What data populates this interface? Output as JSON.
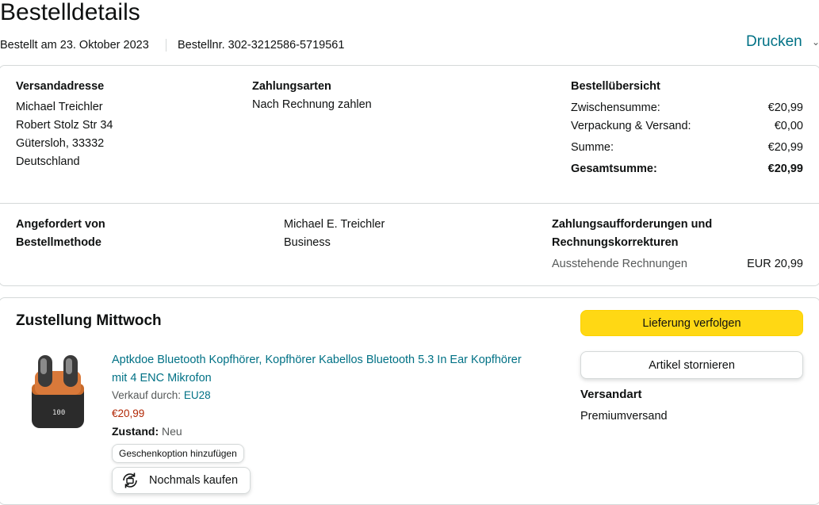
{
  "page": {
    "title": "Bestelldetails",
    "ordered_on": "Bestellt am 23. Oktober 2023",
    "order_number": "Bestellnr. 302-3212586-5719561",
    "print_label": "Drucken"
  },
  "shipping_address": {
    "heading": "Versandadresse",
    "lines": [
      "Michael Treichler",
      "Robert Stolz Str 34",
      "Gütersloh, 33332",
      "Deutschland"
    ]
  },
  "payment": {
    "heading": "Zahlungsarten",
    "method": "Nach Rechnung zahlen"
  },
  "summary": {
    "heading": "Bestellübersicht",
    "rows": [
      {
        "label": "Zwischensumme:",
        "value": "€20,99"
      },
      {
        "label": "Verpackung & Versand:",
        "value": "€0,00"
      },
      {
        "label": "Summe:",
        "value": "€20,99"
      }
    ],
    "total_label": "Gesamtsumme:",
    "total_value": "€20,99"
  },
  "request": {
    "requested_by_label": "Angefordert von",
    "order_method_label": "Bestellmethode",
    "requested_by_value": "Michael E. Treichler",
    "order_method_value": "Business"
  },
  "invoices": {
    "heading_line1": "Zahlungsaufforderungen und",
    "heading_line2": "Rechnungskorrekturen",
    "outstanding_label": "Ausstehende Rechnungen",
    "outstanding_value": "EUR 20,99"
  },
  "delivery": {
    "title": "Zustellung Mittwoch",
    "track_button": "Lieferung verfolgen",
    "cancel_button": "Artikel stornieren",
    "shipping_type_label": "Versandart",
    "shipping_type_value": "Premiumversand"
  },
  "item": {
    "name_line1": "Aptkdoe Bluetooth Kopfhörer, Kopfhörer Kabellos Bluetooth 5.3 In Ear Kopfhörer",
    "name_line2": "mit 4 ENC Mikrofon",
    "sold_by_label": "Verkauf durch:",
    "seller": "EU28",
    "price": "€20,99",
    "condition_label": "Zustand:",
    "condition_value": "Neu",
    "gift_option": "Geschenkoption hinzufügen",
    "buy_again": "Nochmals kaufen",
    "case_display": "100"
  },
  "colors": {
    "link": "#007185",
    "price": "#b12704",
    "button_yellow": "#ffd814",
    "border": "#d5d9d9"
  }
}
